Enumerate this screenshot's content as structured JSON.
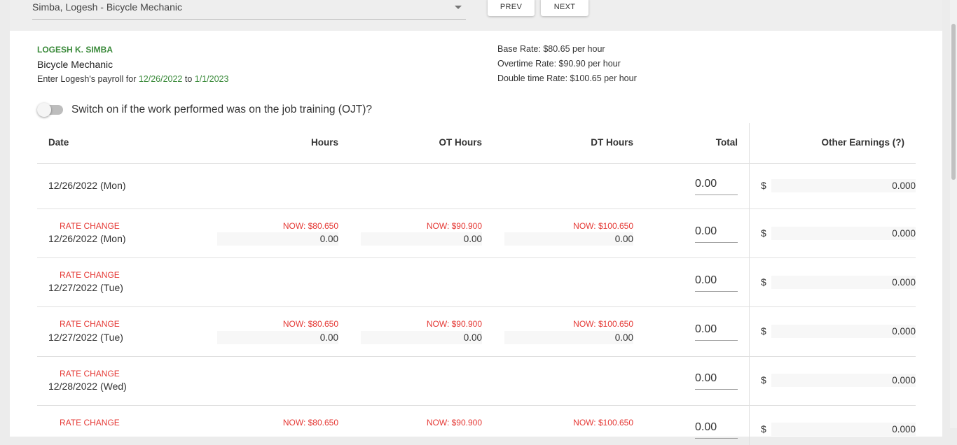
{
  "topbar": {
    "employee_select": "Simba, Logesh - Bicycle Mechanic",
    "prev_label": "PREV",
    "next_label": "NEXT"
  },
  "employee": {
    "name": "LOGESH K. SIMBA",
    "title": "Bicycle Mechanic",
    "period_prefix": "Enter Logesh's payroll for ",
    "period_start": "12/26/2022",
    "period_mid": " to ",
    "period_end": "1/1/2023"
  },
  "rates": {
    "base": "Base Rate: $80.65 per hour",
    "overtime": "Overtime Rate: $90.90 per hour",
    "double": "Double time Rate: $100.65 per hour"
  },
  "ojt": {
    "label": "Switch on if the work performed was on the job training (OJT)?",
    "on": false
  },
  "table": {
    "headers": {
      "date": "Date",
      "hours": "Hours",
      "ot": "OT Hours",
      "dt": "DT Hours",
      "total": "Total",
      "other": "Other Earnings (?)"
    },
    "rows": [
      {
        "rate_change": "",
        "date": "12/26/2022 (Mon)",
        "total": "0.00",
        "other_currency": "$",
        "other": "0.000"
      },
      {
        "rate_change": "RATE CHANGE",
        "date": "12/26/2022 (Mon)",
        "now_hours": "NOW: $80.650",
        "hours": "0.00",
        "now_ot": "NOW: $90.900",
        "ot": "0.00",
        "now_dt": "NOW: $100.650",
        "dt": "0.00",
        "total": "0.00",
        "other_currency": "$",
        "other": "0.000"
      },
      {
        "rate_change": "RATE CHANGE",
        "date": "12/27/2022 (Tue)",
        "total": "0.00",
        "other_currency": "$",
        "other": "0.000"
      },
      {
        "rate_change": "RATE CHANGE",
        "date": "12/27/2022 (Tue)",
        "now_hours": "NOW: $80.650",
        "hours": "0.00",
        "now_ot": "NOW: $90.900",
        "ot": "0.00",
        "now_dt": "NOW: $100.650",
        "dt": "0.00",
        "total": "0.00",
        "other_currency": "$",
        "other": "0.000"
      },
      {
        "rate_change": "RATE CHANGE",
        "date": "12/28/2022 (Wed)",
        "total": "0.00",
        "other_currency": "$",
        "other": "0.000"
      },
      {
        "rate_change": "RATE CHANGE",
        "now_hours": "NOW: $80.650",
        "now_ot": "NOW: $90.900",
        "now_dt": "NOW: $100.650",
        "total": "0.00",
        "other_currency": "$",
        "other": "0.000"
      }
    ]
  }
}
